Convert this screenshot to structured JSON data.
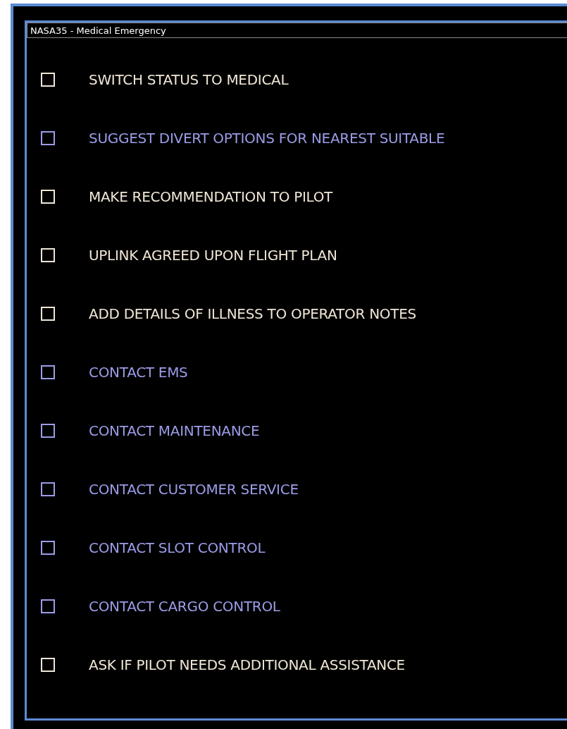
{
  "window": {
    "title": "NASA35 - Medical Emergency"
  },
  "checklist": [
    {
      "label": "SWITCH STATUS TO MEDICAL",
      "checked": false,
      "color": "#efe6d6"
    },
    {
      "label": "SUGGEST DIVERT OPTIONS FOR NEAREST SUITABLE",
      "checked": false,
      "color": "#9c9ce8"
    },
    {
      "label": "MAKE RECOMMENDATION TO PILOT",
      "checked": false,
      "color": "#efe6d6"
    },
    {
      "label": "UPLINK AGREED UPON FLIGHT PLAN",
      "checked": false,
      "color": "#efe6d6"
    },
    {
      "label": "ADD DETAILS OF ILLNESS TO OPERATOR NOTES",
      "checked": false,
      "color": "#efe6d6"
    },
    {
      "label": "CONTACT EMS",
      "checked": false,
      "color": "#9c9ce8"
    },
    {
      "label": "CONTACT MAINTENANCE",
      "checked": false,
      "color": "#9c9ce8"
    },
    {
      "label": "CONTACT CUSTOMER SERVICE",
      "checked": false,
      "color": "#9c9ce8"
    },
    {
      "label": "CONTACT SLOT CONTROL",
      "checked": false,
      "color": "#9c9ce8"
    },
    {
      "label": "CONTACT CARGO CONTROL",
      "checked": false,
      "color": "#9c9ce8"
    },
    {
      "label": "ASK IF PILOT NEEDS ADDITIONAL ASSISTANCE",
      "checked": false,
      "color": "#efe6d6"
    }
  ]
}
